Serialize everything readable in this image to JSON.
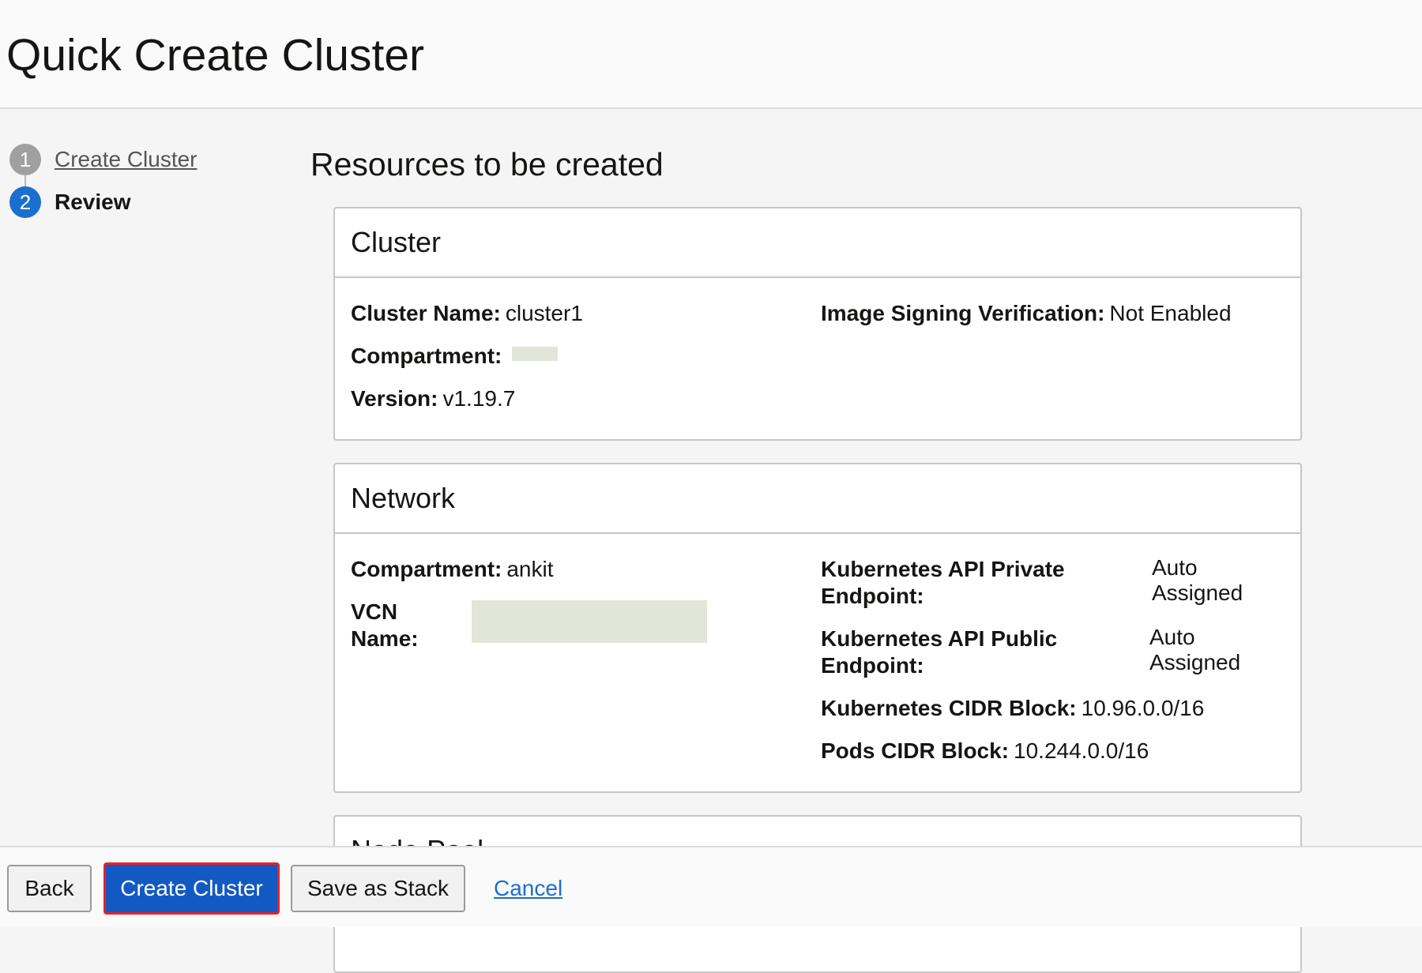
{
  "page": {
    "title": "Quick Create Cluster"
  },
  "steps": [
    {
      "number": "1",
      "label": "Create Cluster"
    },
    {
      "number": "2",
      "label": "Review"
    }
  ],
  "section_title": "Resources to be created",
  "cluster": {
    "heading": "Cluster",
    "name_label": "Cluster Name:",
    "name_value": "cluster1",
    "compartment_label": "Compartment:",
    "version_label": "Version:",
    "version_value": "v1.19.7",
    "image_signing_label": "Image Signing Verification:",
    "image_signing_value": "Not Enabled"
  },
  "network": {
    "heading": "Network",
    "compartment_label": "Compartment:",
    "compartment_value": "ankit",
    "vcn_label_line1": "VCN",
    "vcn_label_line2": "Name:",
    "private_endpoint_label_line1": "Kubernetes API Private",
    "private_endpoint_label_line2": "Endpoint:",
    "private_endpoint_value_line1": "Auto",
    "private_endpoint_value_line2": "Assigned",
    "public_endpoint_label_line1": "Kubernetes API Public",
    "public_endpoint_label_line2": "Endpoint:",
    "public_endpoint_value_line1": "Auto",
    "public_endpoint_value_line2": "Assigned",
    "k8s_cidr_label": "Kubernetes CIDR Block:",
    "k8s_cidr_value": "10.96.0.0/16",
    "pods_cidr_label": "Pods CIDR Block:",
    "pods_cidr_value": "10.244.0.0/16"
  },
  "node_pool": {
    "heading": "Node Pool"
  },
  "footer": {
    "back_label": "Back",
    "create_label": "Create Cluster",
    "save_stack_label": "Save as Stack",
    "cancel_label": "Cancel"
  },
  "colors": {
    "primary_button": "#1259c3",
    "highlight_border": "#e8202a",
    "active_step": "#1b6fcf",
    "inactive_step": "#a0a0a0",
    "redaction": "#e1e6d8"
  }
}
